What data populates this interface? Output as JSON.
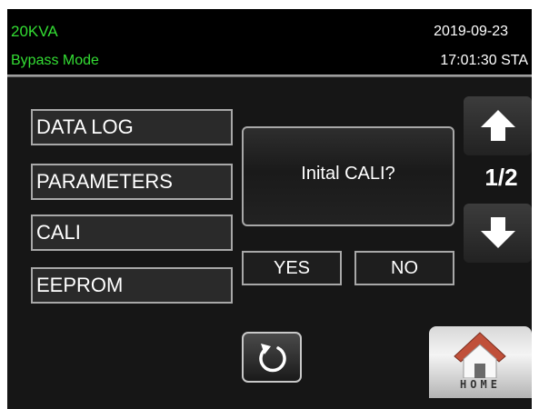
{
  "header": {
    "model": "20KVA",
    "mode": "Bypass Mode",
    "date": "2019-09-23",
    "time": "17:01:30 STA"
  },
  "menu": {
    "items": [
      {
        "label": "DATA LOG"
      },
      {
        "label": "PARAMETERS"
      },
      {
        "label": "CALI"
      },
      {
        "label": "EEPROM"
      }
    ]
  },
  "dialog": {
    "message": "Inital CALI?",
    "yes_label": "YES",
    "no_label": "NO"
  },
  "pagination": {
    "indicator": "1/2",
    "up_icon": "arrow-up-icon",
    "down_icon": "arrow-down-icon"
  },
  "footer": {
    "back_icon": "refresh-back-icon",
    "home_label": "HOME",
    "home_icon": "house-icon"
  },
  "colors": {
    "status_text": "#33dd33",
    "background": "#000000",
    "border": "#a8a8a8",
    "house_roof": "#c0503a"
  }
}
